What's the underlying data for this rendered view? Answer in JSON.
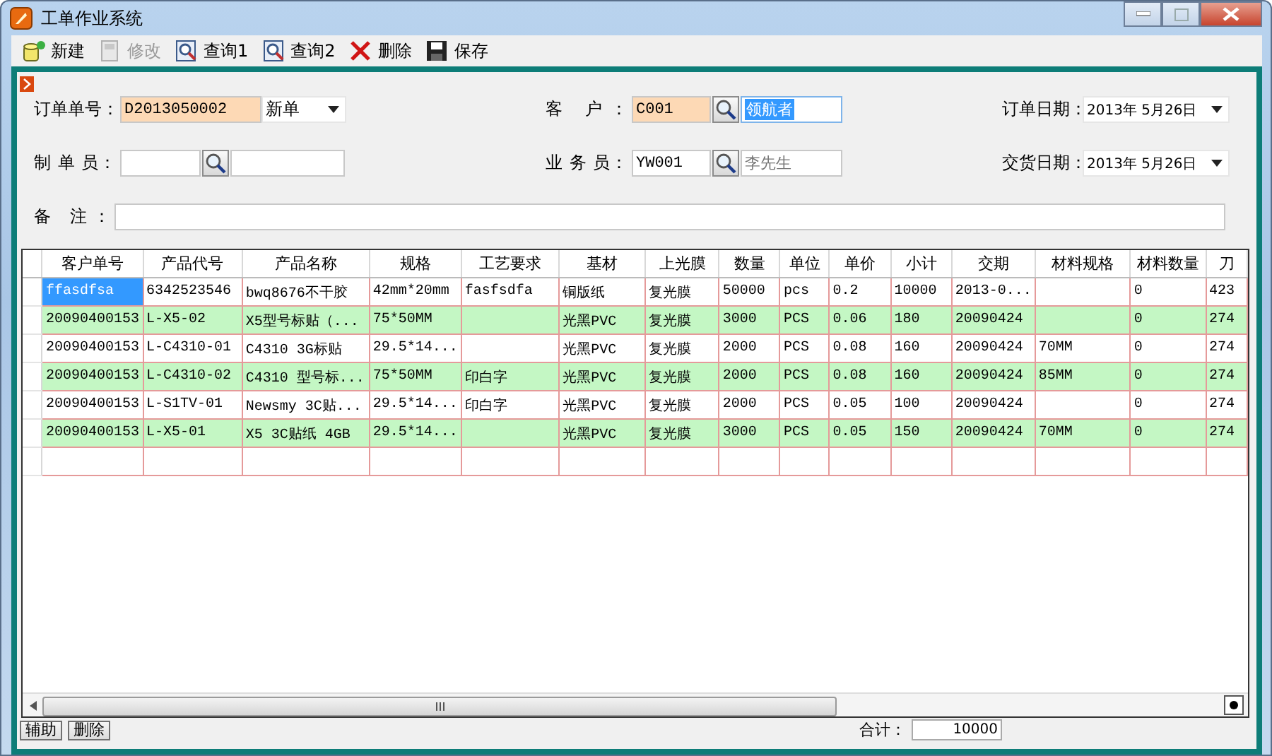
{
  "window": {
    "title": "工单作业系统"
  },
  "toolbar": [
    {
      "label": "新建",
      "kind": "new",
      "disabled": false
    },
    {
      "label": "修改",
      "kind": "edit",
      "disabled": true
    },
    {
      "label": "查询1",
      "kind": "query",
      "disabled": false
    },
    {
      "label": "查询2",
      "kind": "query",
      "disabled": false
    },
    {
      "label": "删除",
      "kind": "delete",
      "disabled": false
    },
    {
      "label": "保存",
      "kind": "save",
      "disabled": false
    }
  ],
  "form": {
    "order_no": {
      "label": "订单单号：",
      "value": "D2013050002",
      "status": "新单"
    },
    "customer": {
      "label": "客 户：",
      "code": "C001",
      "name": "领航者"
    },
    "order_date": {
      "label": "订单日期：",
      "value": "2013年 5月26日"
    },
    "maker": {
      "label": "制 单 员："
    },
    "salesman": {
      "label": "业 务 员：",
      "code": "YW001",
      "name": "李先生"
    },
    "delivery_date": {
      "label": "交货日期：",
      "value": "2013年 5月26日"
    },
    "notes": {
      "label": "备 注："
    }
  },
  "table": {
    "columns": [
      "客户单号",
      "产品代号",
      "产品名称",
      "规格",
      "工艺要求",
      "基材",
      "上光膜",
      "数量",
      "单位",
      "单价",
      "小计",
      "交期",
      "材料规格",
      "材料数量",
      "刀"
    ],
    "rows": [
      {
        "selected": true,
        "cells": [
          "ffasdfsa",
          "6342523546",
          "bwq8676不干胶",
          "42mm*20mm",
          "fasfsdfa",
          "铜版纸",
          "复光膜",
          "50000",
          "pcs",
          "0.2",
          "10000",
          "2013-0...",
          "",
          "0",
          "423"
        ]
      },
      {
        "selected": false,
        "cells": [
          "20090400153",
          "L-X5-02",
          "X5型号标贴（...",
          "75*50MM",
          "",
          "光黑PVC",
          "复光膜",
          "3000",
          "PCS",
          "0.06",
          "180",
          "20090424",
          "",
          "0",
          "274"
        ]
      },
      {
        "selected": false,
        "cells": [
          "20090400153",
          "L-C4310-01",
          "C4310 3G标贴",
          "29.5*14...",
          "",
          "光黑PVC",
          "复光膜",
          "2000",
          "PCS",
          "0.08",
          "160",
          "20090424",
          "70MM",
          "0",
          "274"
        ]
      },
      {
        "selected": false,
        "cells": [
          "20090400153",
          "L-C4310-02",
          "C4310 型号标...",
          "75*50MM",
          "印白字",
          "光黑PVC",
          "复光膜",
          "2000",
          "PCS",
          "0.08",
          "160",
          "20090424",
          "85MM",
          "0",
          "274"
        ]
      },
      {
        "selected": false,
        "cells": [
          "20090400153",
          "L-S1TV-01",
          "Newsmy 3C贴...",
          "29.5*14...",
          "印白字",
          "光黑PVC",
          "复光膜",
          "2000",
          "PCS",
          "0.05",
          "100",
          "20090424",
          "",
          "0",
          "274"
        ]
      },
      {
        "selected": false,
        "cells": [
          "20090400153",
          "L-X5-01",
          "X5 3C贴纸 4GB",
          "29.5*14...",
          "",
          "光黑PVC",
          "复光膜",
          "3000",
          "PCS",
          "0.05",
          "150",
          "20090424",
          "70MM",
          "0",
          "274"
        ]
      }
    ]
  },
  "footer": {
    "buttons": [
      "辅助",
      "删除"
    ],
    "total_label": "合计：",
    "total_value": "10000"
  }
}
